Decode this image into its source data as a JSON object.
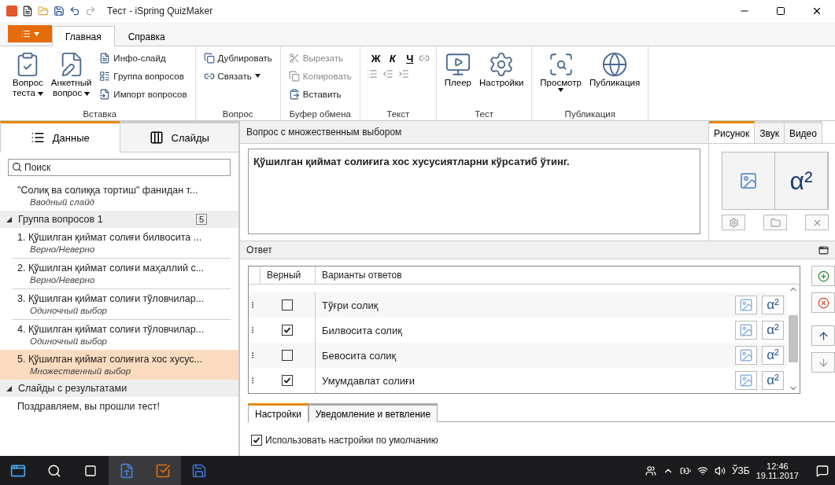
{
  "window": {
    "title": "Тест - iSpring QuizMaker"
  },
  "ribbon": {
    "tabs": [
      {
        "label": "Главная",
        "selected": true
      },
      {
        "label": "Справка",
        "selected": false
      }
    ],
    "groups": [
      {
        "label": "Вставка",
        "items": [
          {
            "kind": "large",
            "lines": [
              "Вопрос",
              "теста"
            ],
            "dropdown": true
          },
          {
            "kind": "large",
            "lines": [
              "Анкетный",
              "вопрос"
            ],
            "dropdown": true
          },
          {
            "kind": "small",
            "label": "Инфо-слайд",
            "disabled": false
          },
          {
            "kind": "small",
            "label": "Группа вопросов",
            "disabled": false
          },
          {
            "kind": "small",
            "label": "Импорт вопросов",
            "disabled": false
          }
        ]
      },
      {
        "label": "Вопрос",
        "items": [
          {
            "kind": "small",
            "label": "Дублировать",
            "disabled": false
          },
          {
            "kind": "small",
            "label": "Связать",
            "disabled": false,
            "dropdown": true
          }
        ]
      },
      {
        "label": "Буфер обмена",
        "items": [
          {
            "kind": "small",
            "label": "Вырезать",
            "disabled": true
          },
          {
            "kind": "small",
            "label": "Копировать",
            "disabled": true
          },
          {
            "kind": "small",
            "label": "Вставить",
            "disabled": false
          }
        ]
      },
      {
        "label": "Текст",
        "items": [
          {
            "kind": "format",
            "label": "Ж"
          },
          {
            "kind": "format",
            "label": "К"
          },
          {
            "kind": "format",
            "label": "Ч"
          }
        ]
      },
      {
        "label": "Тест",
        "items": [
          {
            "kind": "large",
            "lines": [
              "Плеер"
            ]
          },
          {
            "kind": "large",
            "lines": [
              "Настройки"
            ]
          }
        ]
      },
      {
        "label": "Публикация",
        "items": [
          {
            "kind": "large",
            "lines": [
              "Просмотр"
            ],
            "dropdown": true
          },
          {
            "kind": "large",
            "lines": [
              "Публикация"
            ]
          }
        ]
      }
    ]
  },
  "sidebar": {
    "tabs": [
      {
        "label": "Данные",
        "selected": true
      },
      {
        "label": "Слайды",
        "selected": false
      }
    ],
    "search": {
      "placeholder": "Поиск"
    },
    "intro": {
      "title": "\"Солиқ ва солиққа тортиш\" фанидан т...",
      "subtitle": "Вводный слайд"
    },
    "groups": [
      {
        "title": "Группа вопросов 1",
        "count": "5",
        "expanded": true,
        "children": [
          {
            "title": "1. Қўшилган қиймат солиғи билвосита ...",
            "subtitle": "Верно/Неверно",
            "selected": false
          },
          {
            "title": "2. Қўшилган қиймат солиғи маҳаллий с...",
            "subtitle": "Верно/Неверно",
            "selected": false
          },
          {
            "title": "3. Қўшилган қиймат солиғи тўловчилар...",
            "subtitle": "Одиночный выбор",
            "selected": false
          },
          {
            "title": "4. Қўшилган қиймат солиғи тўловчилар...",
            "subtitle": "Одиночный выбор",
            "selected": false
          },
          {
            "title": "5. Қўшилган қиймат солиғига хос хусус...",
            "subtitle": "Множественный выбор",
            "selected": true
          }
        ]
      },
      {
        "title": "Слайды с результатами",
        "expanded": true,
        "children": [
          {
            "title": "Поздравляем, вы прошли тест!",
            "selected": false
          }
        ]
      }
    ]
  },
  "question": {
    "header": "Вопрос с множественным выбором",
    "text": "Қўшилган қиймат солиғига хос хусусиятларни кўрсатиб ўтинг."
  },
  "media": {
    "formula_button": "α²",
    "tabs": [
      {
        "label": "Рисунок",
        "selected": true
      },
      {
        "label": "Звук",
        "selected": false
      },
      {
        "label": "Видео",
        "selected": false
      }
    ]
  },
  "answers": {
    "header": "Ответ",
    "columns": [
      "Верный",
      "Варианты ответов"
    ],
    "rows": [
      {
        "checked": false,
        "text": "Тўғри солиқ",
        "formula_button": "α²"
      },
      {
        "checked": true,
        "text": "Билвосита солиқ",
        "formula_button": "α²"
      },
      {
        "checked": false,
        "text": "Бевосита солиқ",
        "formula_button": "α²"
      },
      {
        "checked": true,
        "text": "Умумдавлат солиғи",
        "formula_button": "α²"
      }
    ]
  },
  "settings": {
    "tabs": [
      {
        "label": "Настройки",
        "selected": true
      },
      {
        "label": "Уведомление и ветвление",
        "selected": false
      }
    ],
    "use_default": {
      "label": "Использовать настройки по умолчанию",
      "checked": true
    }
  },
  "taskbar": {
    "language": "ЎЗБ",
    "time": "12:46",
    "date": "19.11.2017"
  }
}
